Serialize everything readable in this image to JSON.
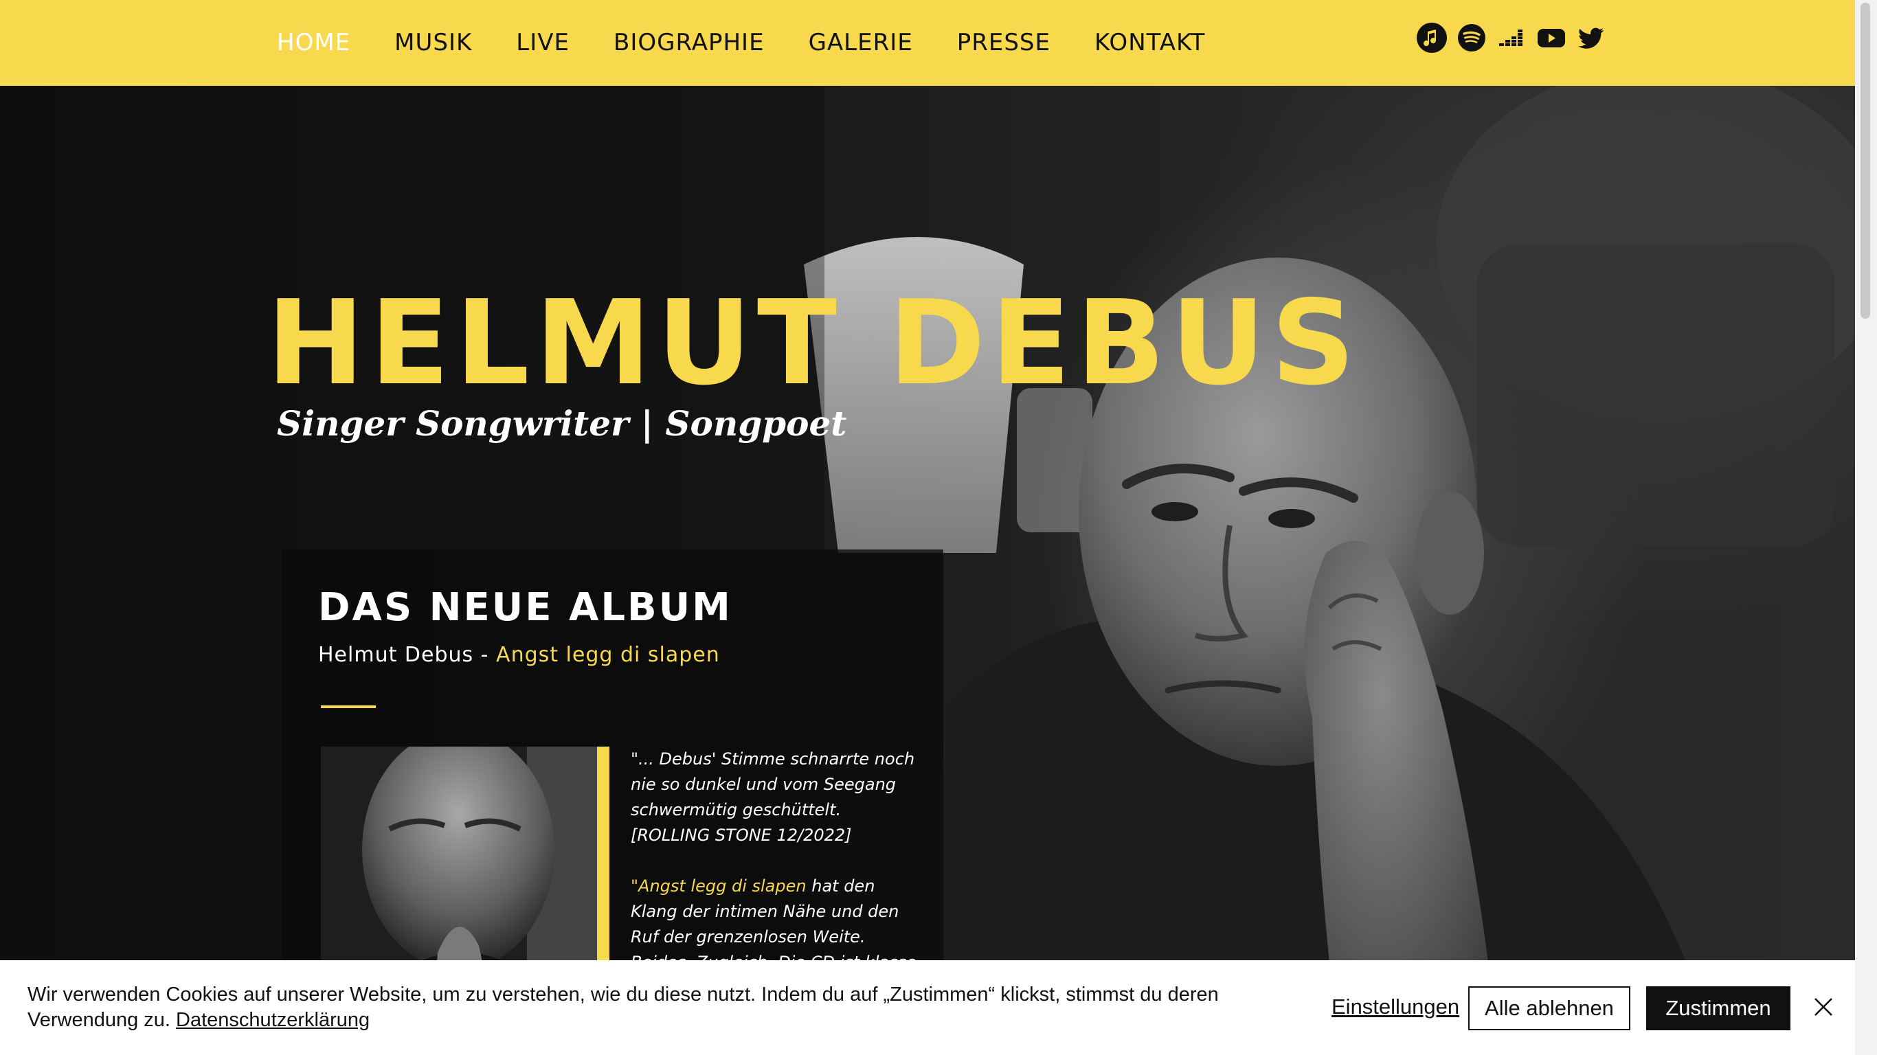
{
  "nav": {
    "items": [
      {
        "label": "HOME",
        "active": true
      },
      {
        "label": "MUSIK",
        "active": false
      },
      {
        "label": "LIVE",
        "active": false
      },
      {
        "label": "BIOGRAPHIE",
        "active": false
      },
      {
        "label": "GALERIE",
        "active": false
      },
      {
        "label": "PRESSE",
        "active": false
      },
      {
        "label": "KONTAKT",
        "active": false
      }
    ]
  },
  "social": {
    "icons": [
      "apple-music-icon",
      "spotify-icon",
      "deezer-icon",
      "youtube-icon",
      "twitter-icon"
    ]
  },
  "hero": {
    "title": "HELMUT DEBUS",
    "subtitle": "Singer Songwriter | Songpoet"
  },
  "album": {
    "heading": "DAS NEUE ALBUM",
    "artist": "Helmut Debus",
    "separator": " - ",
    "title": "Angst legg di slapen",
    "quote1": "\"... Debus' Stimme schnarrte noch nie so dunkel und vom Seegang schwermütig geschüttelt.",
    "quote1_source": "[ROLLING STONE 12/2022]",
    "quote2_highlight": "\"Angst legg di slapen",
    "quote2_rest": " hat den Klang der intimen Nähe und den Ruf der grenzenlosen Weite. Beides. Zugleich. Die CD ist klasse. Weltklasse.\""
  },
  "cookie": {
    "text": "Wir verwenden Cookies auf unserer Website, um zu verstehen, wie du diese nutzt. Indem du auf „Zustimmen“ klickst, stimmst du deren Verwendung zu. ",
    "privacy_link": "Datenschutzerklärung",
    "settings_label": "Einstellungen",
    "reject_label": "Alle ablehnen",
    "accept_label": "Zustimmen"
  },
  "colors": {
    "accent": "#f8d84c",
    "header_bg": "#f8d84c",
    "dark": "#0d0d0d"
  }
}
